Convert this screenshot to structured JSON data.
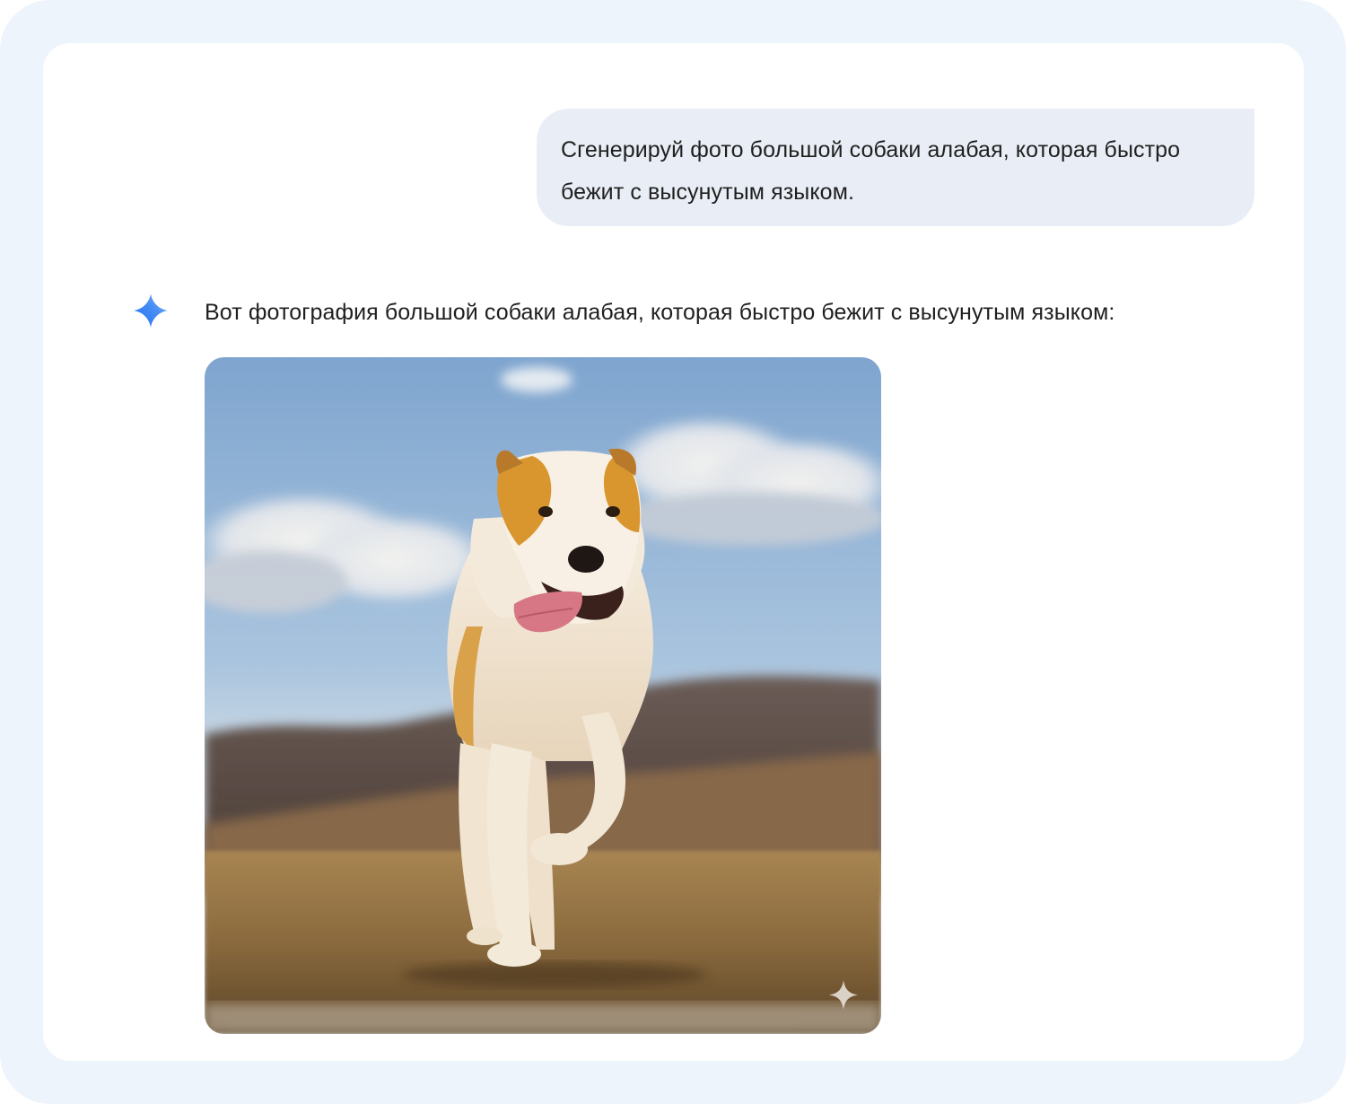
{
  "conversation": {
    "user_prompt": "Сгенерируй фото большой собаки алабая, которая быстро бежит с высунутым языком.",
    "assistant_response": "Вот фотография большой собаки алабая, которая быстро бежит с высунутым языком:",
    "assistant_icon": "gemini-sparkle-icon",
    "image_watermark_icon": "sparkle-watermark-icon"
  },
  "colors": {
    "frame_background": "#eef4fb",
    "user_bubble": "#e9eef6",
    "text": "#1f1f1f",
    "gemini_blue": "#4285f4"
  }
}
